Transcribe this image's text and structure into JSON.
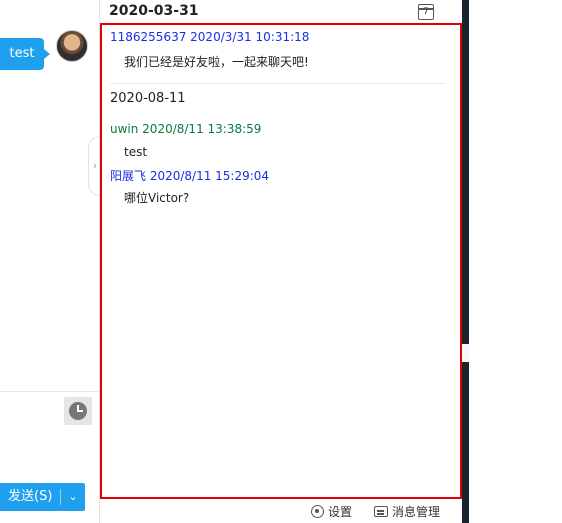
{
  "chat": {
    "bubble_text": "test",
    "send_label": "发送(S)",
    "send_dropdown_glyph": "⌄",
    "collapse_glyph": "›"
  },
  "history": {
    "top_date": "2020-03-31",
    "calendar_day": "7",
    "messages_group1": [
      {
        "header": "1186255637  2020/3/31 10:31:18",
        "body": "我们已经是好友啦，一起来聊天吧!",
        "color": "#1a2ee6"
      }
    ],
    "date_divider": "2020-08-11",
    "messages_group2": [
      {
        "header": "uwin  2020/8/11 13:38:59",
        "body": "test",
        "color": "#0a7a3c"
      },
      {
        "header": "阳展飞  2020/8/11 15:29:04",
        "body": "哪位Victor?",
        "color": "#1a2ee6"
      }
    ]
  },
  "toolbar": {
    "settings_label": "设置",
    "message_manager_label": "消息管理"
  },
  "icons": [
    "avatar",
    "clock-icon",
    "calendar-icon",
    "settings-icon",
    "message-manager-icon",
    "chevron-right-icon",
    "chevron-down-icon"
  ],
  "colors": {
    "accent": "#1fa0ef",
    "highlight_border": "#e00000"
  }
}
